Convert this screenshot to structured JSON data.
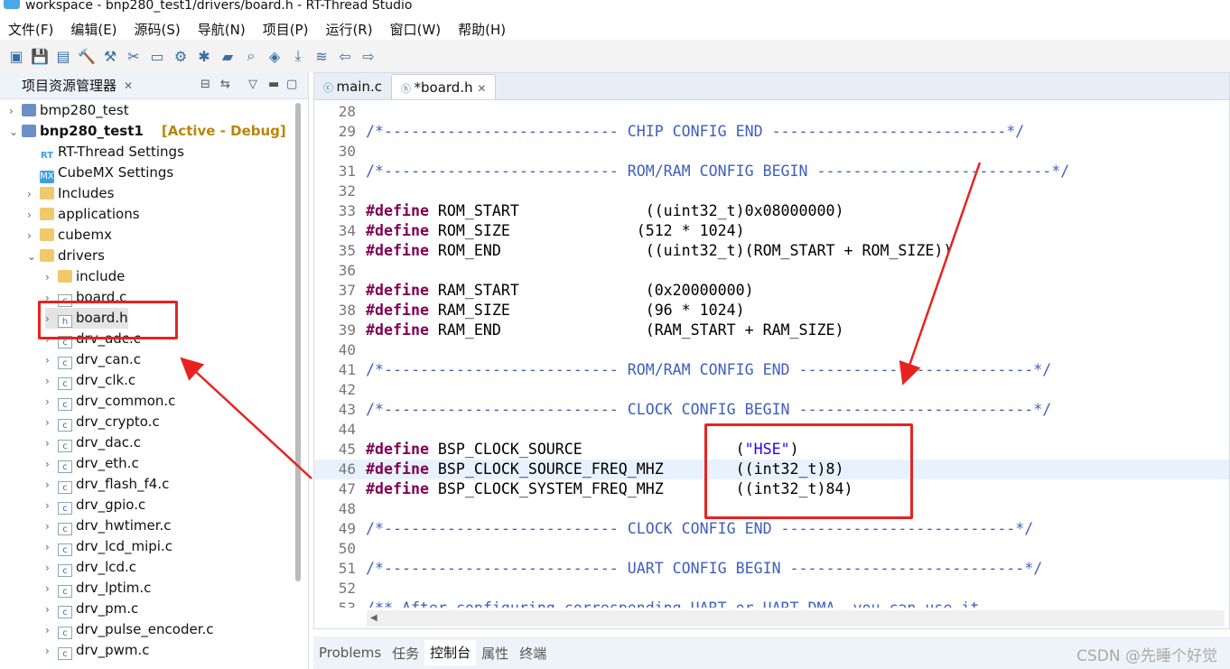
{
  "window_title": "workspace - bnp280_test1/drivers/board.h - RT-Thread Studio",
  "menu": [
    "文件(F)",
    "编辑(E)",
    "源码(S)",
    "导航(N)",
    "项目(P)",
    "运行(R)",
    "窗口(W)",
    "帮助(H)"
  ],
  "toolbar_icons": [
    "new-icon",
    "save-icon",
    "save-all-icon",
    "build-icon",
    "clean-icon",
    "tools-icon",
    "monitor-icon",
    "settings-icon",
    "debug-icon",
    "open-folder-icon",
    "search-icon",
    "book-icon",
    "download-icon",
    "layers-icon",
    "back-icon",
    "forward-icon"
  ],
  "explorer": {
    "title": "项目资源管理器",
    "items": [
      {
        "label": "bmp280_test",
        "level": 0,
        "type": "project",
        "expanded": false
      },
      {
        "label": "bnp280_test1",
        "level": 0,
        "type": "project",
        "expanded": true,
        "bold": true,
        "tag": "[Active - Debug]"
      },
      {
        "label": "RT-Thread Settings",
        "level": 1,
        "type": "rt"
      },
      {
        "label": "CubeMX Settings",
        "level": 1,
        "type": "mx"
      },
      {
        "label": "Includes",
        "level": 1,
        "type": "inc",
        "expanded": false
      },
      {
        "label": "applications",
        "level": 1,
        "type": "folder",
        "expanded": false
      },
      {
        "label": "cubemx",
        "level": 1,
        "type": "folder",
        "expanded": false
      },
      {
        "label": "drivers",
        "level": 1,
        "type": "folder",
        "expanded": true
      },
      {
        "label": "include",
        "level": 2,
        "type": "folder",
        "expanded": false
      },
      {
        "label": "board.c",
        "level": 2,
        "type": "c"
      },
      {
        "label": "board.h",
        "level": 2,
        "type": "h",
        "selected": true
      },
      {
        "label": "drv_adc.c",
        "level": 2,
        "type": "c"
      },
      {
        "label": "drv_can.c",
        "level": 2,
        "type": "c"
      },
      {
        "label": "drv_clk.c",
        "level": 2,
        "type": "c"
      },
      {
        "label": "drv_common.c",
        "level": 2,
        "type": "c"
      },
      {
        "label": "drv_crypto.c",
        "level": 2,
        "type": "c"
      },
      {
        "label": "drv_dac.c",
        "level": 2,
        "type": "c"
      },
      {
        "label": "drv_eth.c",
        "level": 2,
        "type": "c"
      },
      {
        "label": "drv_flash_f4.c",
        "level": 2,
        "type": "c"
      },
      {
        "label": "drv_gpio.c",
        "level": 2,
        "type": "c"
      },
      {
        "label": "drv_hwtimer.c",
        "level": 2,
        "type": "c"
      },
      {
        "label": "drv_lcd_mipi.c",
        "level": 2,
        "type": "c"
      },
      {
        "label": "drv_lcd.c",
        "level": 2,
        "type": "c"
      },
      {
        "label": "drv_lptim.c",
        "level": 2,
        "type": "c"
      },
      {
        "label": "drv_pm.c",
        "level": 2,
        "type": "c"
      },
      {
        "label": "drv_pulse_encoder.c",
        "level": 2,
        "type": "c"
      },
      {
        "label": "drv_pwm.c",
        "level": 2,
        "type": "c"
      }
    ]
  },
  "editor": {
    "tabs": [
      {
        "label": "main.c",
        "active": false
      },
      {
        "label": "*board.h",
        "active": true
      }
    ],
    "lines": [
      {
        "n": "28",
        "t": ""
      },
      {
        "n": "29",
        "t": "/*-------------------------- CHIP CONFIG END --------------------------*/",
        "c": "cmt"
      },
      {
        "n": "30",
        "t": ""
      },
      {
        "n": "31",
        "t": "/*-------------------------- ROM/RAM CONFIG BEGIN --------------------------*/",
        "c": "cmt"
      },
      {
        "n": "32",
        "t": ""
      },
      {
        "n": "33",
        "kw": "#define",
        "t": " ROM_START              ((uint32_t)0x08000000)"
      },
      {
        "n": "34",
        "kw": "#define",
        "t": " ROM_SIZE              (512 * 1024)"
      },
      {
        "n": "35",
        "kw": "#define",
        "t": " ROM_END                ((uint32_t)(ROM_START + ROM_SIZE))"
      },
      {
        "n": "36",
        "t": ""
      },
      {
        "n": "37",
        "kw": "#define",
        "t": " RAM_START              (0x20000000)"
      },
      {
        "n": "38",
        "kw": "#define",
        "t": " RAM_SIZE               (96 * 1024)"
      },
      {
        "n": "39",
        "kw": "#define",
        "t": " RAM_END                (RAM_START + RAM_SIZE)"
      },
      {
        "n": "40",
        "t": ""
      },
      {
        "n": "41",
        "t": "/*-------------------------- ROM/RAM CONFIG END --------------------------*/",
        "c": "cmt"
      },
      {
        "n": "42",
        "t": ""
      },
      {
        "n": "43",
        "t": "/*-------------------------- CLOCK CONFIG BEGIN --------------------------*/",
        "c": "cmt"
      },
      {
        "n": "44",
        "t": ""
      },
      {
        "n": "45",
        "kw": "#define",
        "t": " BSP_CLOCK_SOURCE                 (",
        "s": "\"HSE\"",
        "t2": ")"
      },
      {
        "n": "46",
        "kw": "#define",
        "t": " BSP_CLOCK_SOURCE_FREQ_MHZ        ((int32_t)8)",
        "hl": true
      },
      {
        "n": "47",
        "kw": "#define",
        "t": " BSP_CLOCK_SYSTEM_FREQ_MHZ        ((int32_t)84)"
      },
      {
        "n": "48",
        "t": ""
      },
      {
        "n": "49",
        "t": "/*-------------------------- CLOCK CONFIG END --------------------------*/",
        "c": "cmt"
      },
      {
        "n": "50",
        "t": ""
      },
      {
        "n": "51",
        "t": "/*-------------------------- UART CONFIG BEGIN --------------------------*/",
        "c": "cmt"
      },
      {
        "n": "52",
        "t": ""
      },
      {
        "n": "53",
        "t": "/** After configuring corresponding UART or UART DMA, you can use it",
        "c": "cmt"
      }
    ]
  },
  "bottom_tabs": [
    "Problems",
    "任务",
    "控制台",
    "属性",
    "终端"
  ],
  "watermark": "CSDN @先睡个好觉",
  "colors": {
    "annotation": "#e8231f",
    "comment": "#3f5fbf",
    "keyword": "#7f0055",
    "string": "#2a00ff"
  }
}
